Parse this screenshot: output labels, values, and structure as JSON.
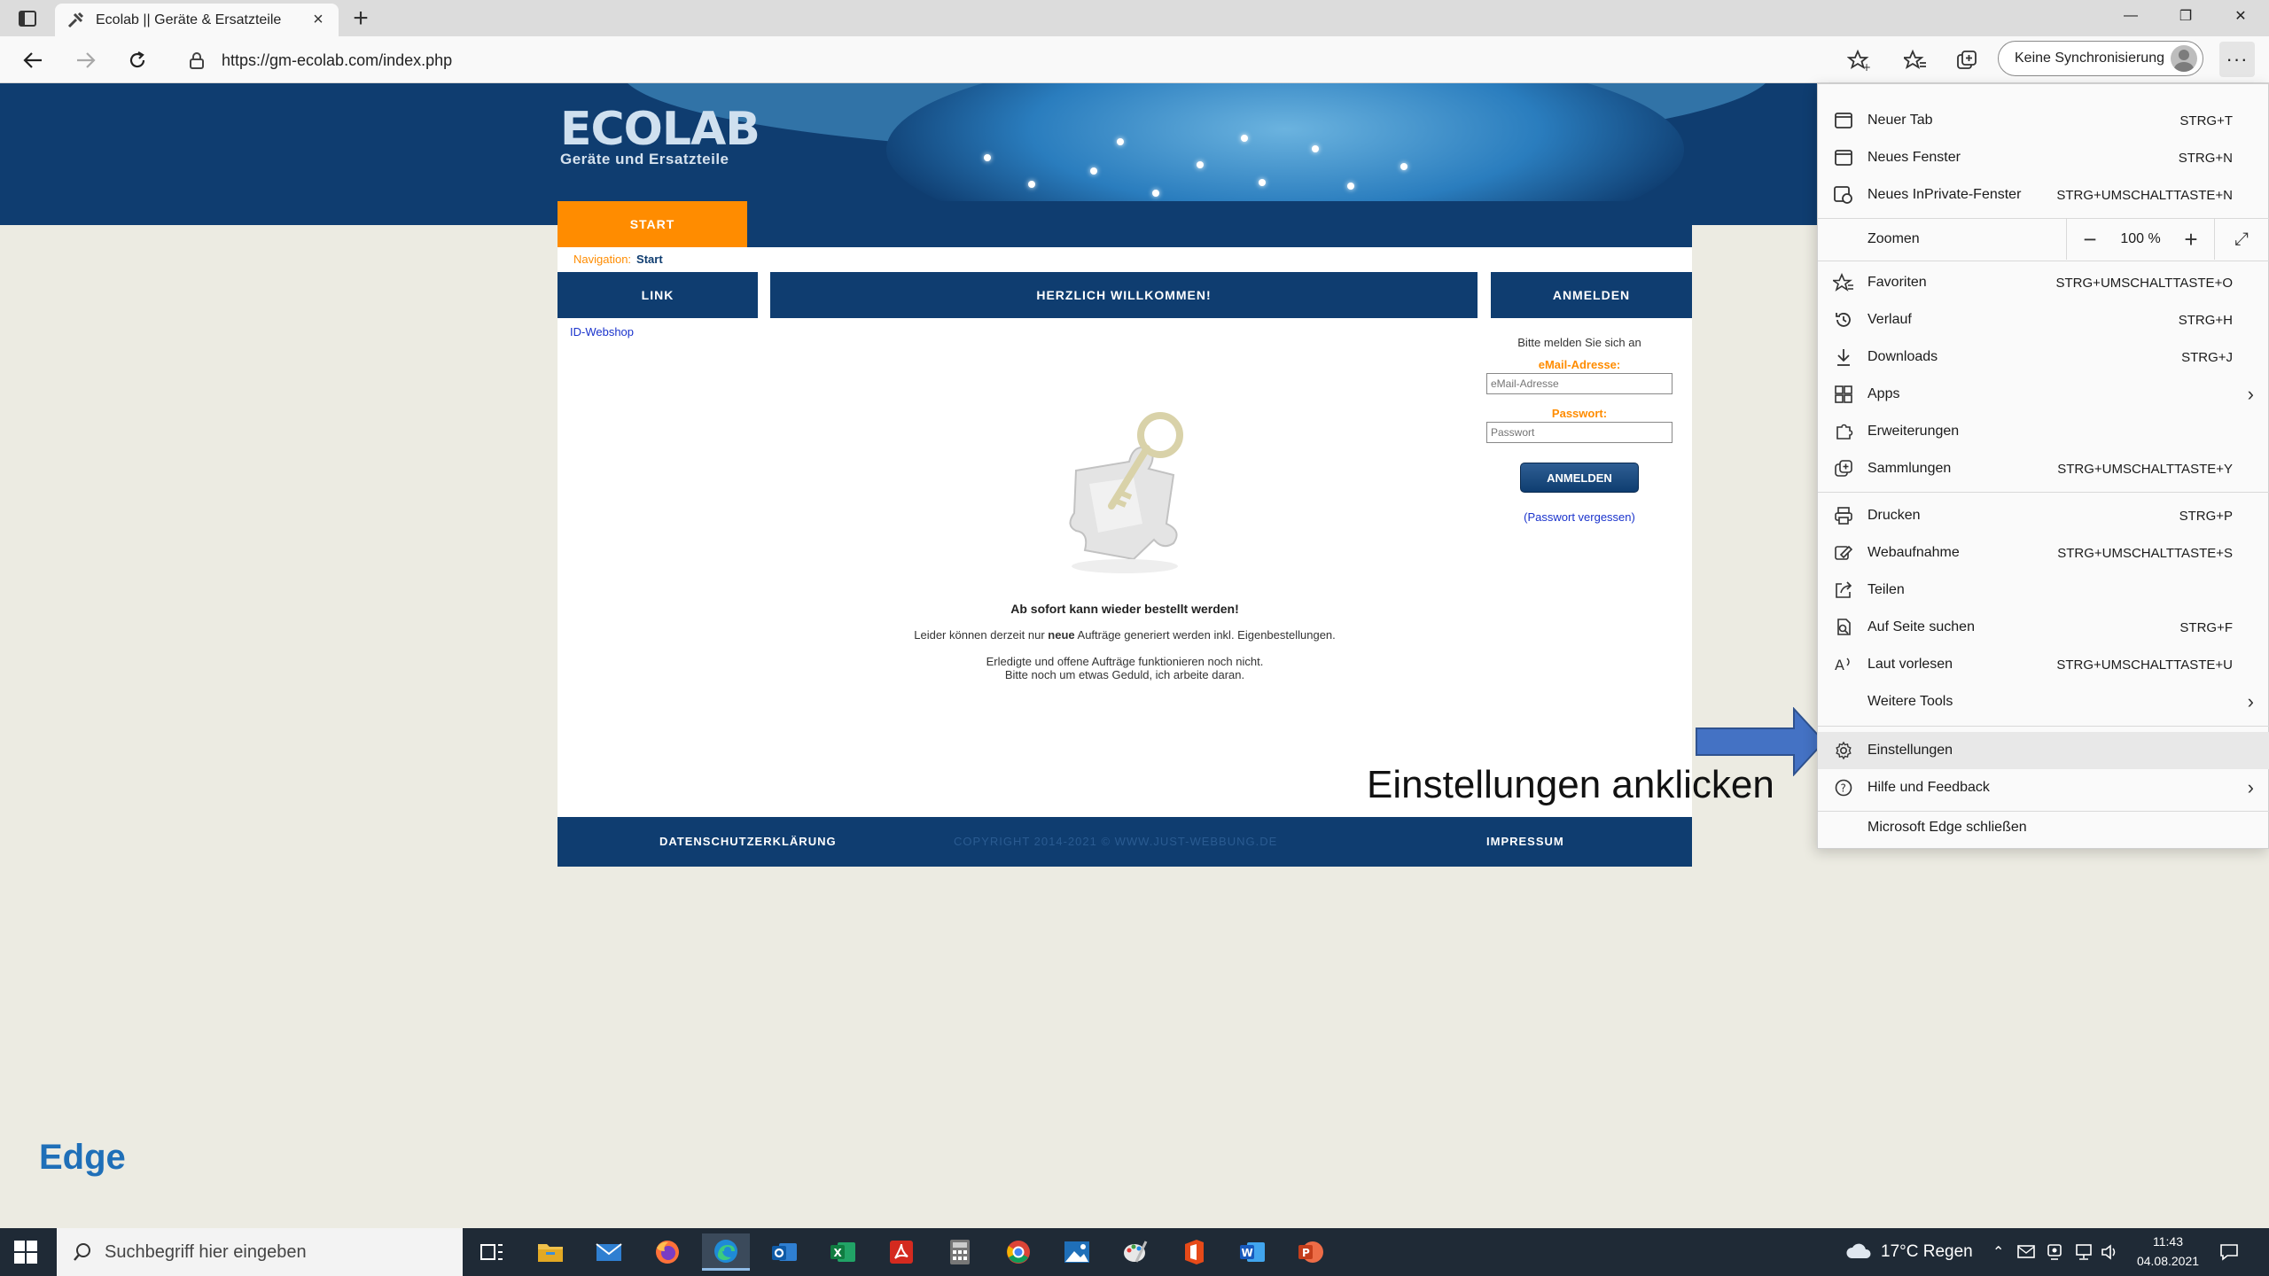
{
  "browser": {
    "tab_title": "Ecolab || Geräte & Ersatzteile",
    "url": "https://gm-ecolab.com/index.php",
    "sync_label": "Keine Synchronisierung",
    "window_controls": {
      "minimize": "—",
      "restore": "❐",
      "close": "✕"
    }
  },
  "site": {
    "logo_name": "ECOLAB",
    "logo_sub": "Geräte und Ersatzteile",
    "nav_start": "START",
    "breadcrumb_label": "Navigation:",
    "breadcrumb_current": "Start",
    "col_link": "LINK",
    "col_welcome": "HERZLICH WILLKOMMEN!",
    "col_login": "ANMELDEN",
    "link_item": "ID-Webshop",
    "headline": "Ab sofort kann wieder bestellt werden!",
    "para1_pre": "Leider können derzeit nur ",
    "para1_bold": "neue",
    "para1_post": " Aufträge generiert werden inkl. Eigenbestellungen.",
    "para2_line1": "Erledigte und offene Aufträge funktionieren noch nicht.",
    "para2_line2": "Bitte noch um etwas Geduld, ich arbeite daran.",
    "login_hint": "Bitte melden Sie sich an",
    "email_label": "eMail-Adresse:",
    "email_placeholder": "eMail-Adresse",
    "password_label": "Passwort:",
    "password_placeholder": "Passwort",
    "login_button": "ANMELDEN",
    "forgot_link": "(Passwort vergessen)",
    "footer_privacy": "DATENSCHUTZERKLÄRUNG",
    "footer_copyright": "COPYRIGHT 2014-2021 © WWW.JUST-WEBBUNG.DE",
    "footer_imprint": "IMPRESSUM"
  },
  "annotation": {
    "instruction": "Einstellungen anklicken",
    "arrow_color": "#4472c4",
    "corner_label": "Edge"
  },
  "menu": {
    "items": [
      {
        "label": "Neuer Tab",
        "shortcut": "STRG+T",
        "icon": "new-tab-icon"
      },
      {
        "label": "Neues Fenster",
        "shortcut": "STRG+N",
        "icon": "new-window-icon"
      },
      {
        "label": "Neues InPrivate-Fenster",
        "shortcut": "STRG+UMSCHALTTASTE+N",
        "icon": "inprivate-icon"
      },
      {
        "label": "Zoomen",
        "zoom_value": "100 %"
      },
      {
        "label": "Favoriten",
        "shortcut": "STRG+UMSCHALTTASTE+O",
        "icon": "favorites-icon"
      },
      {
        "label": "Verlauf",
        "shortcut": "STRG+H",
        "icon": "history-icon"
      },
      {
        "label": "Downloads",
        "shortcut": "STRG+J",
        "icon": "download-icon"
      },
      {
        "label": "Apps",
        "icon": "apps-icon"
      },
      {
        "label": "Erweiterungen",
        "icon": "extensions-icon"
      },
      {
        "label": "Sammlungen",
        "shortcut": "STRG+UMSCHALTTASTE+Y",
        "icon": "collections-icon"
      },
      {
        "label": "Drucken",
        "shortcut": "STRG+P",
        "icon": "print-icon"
      },
      {
        "label": "Webaufnahme",
        "shortcut": "STRG+UMSCHALTTASTE+S",
        "icon": "web-capture-icon"
      },
      {
        "label": "Teilen",
        "icon": "share-icon"
      },
      {
        "label": "Auf Seite suchen",
        "shortcut": "STRG+F",
        "icon": "find-icon"
      },
      {
        "label": "Laut vorlesen",
        "shortcut": "STRG+UMSCHALTTASTE+U",
        "icon": "read-aloud-icon"
      },
      {
        "label": "Weitere Tools"
      },
      {
        "label": "Einstellungen",
        "icon": "gear-icon"
      },
      {
        "label": "Hilfe und Feedback",
        "icon": "help-icon"
      },
      {
        "label": "Microsoft Edge schließen"
      }
    ]
  },
  "taskbar": {
    "search_placeholder": "Suchbegriff hier eingeben",
    "weather": "17°C  Regen",
    "time": "11:43",
    "date": "04.08.2021"
  }
}
